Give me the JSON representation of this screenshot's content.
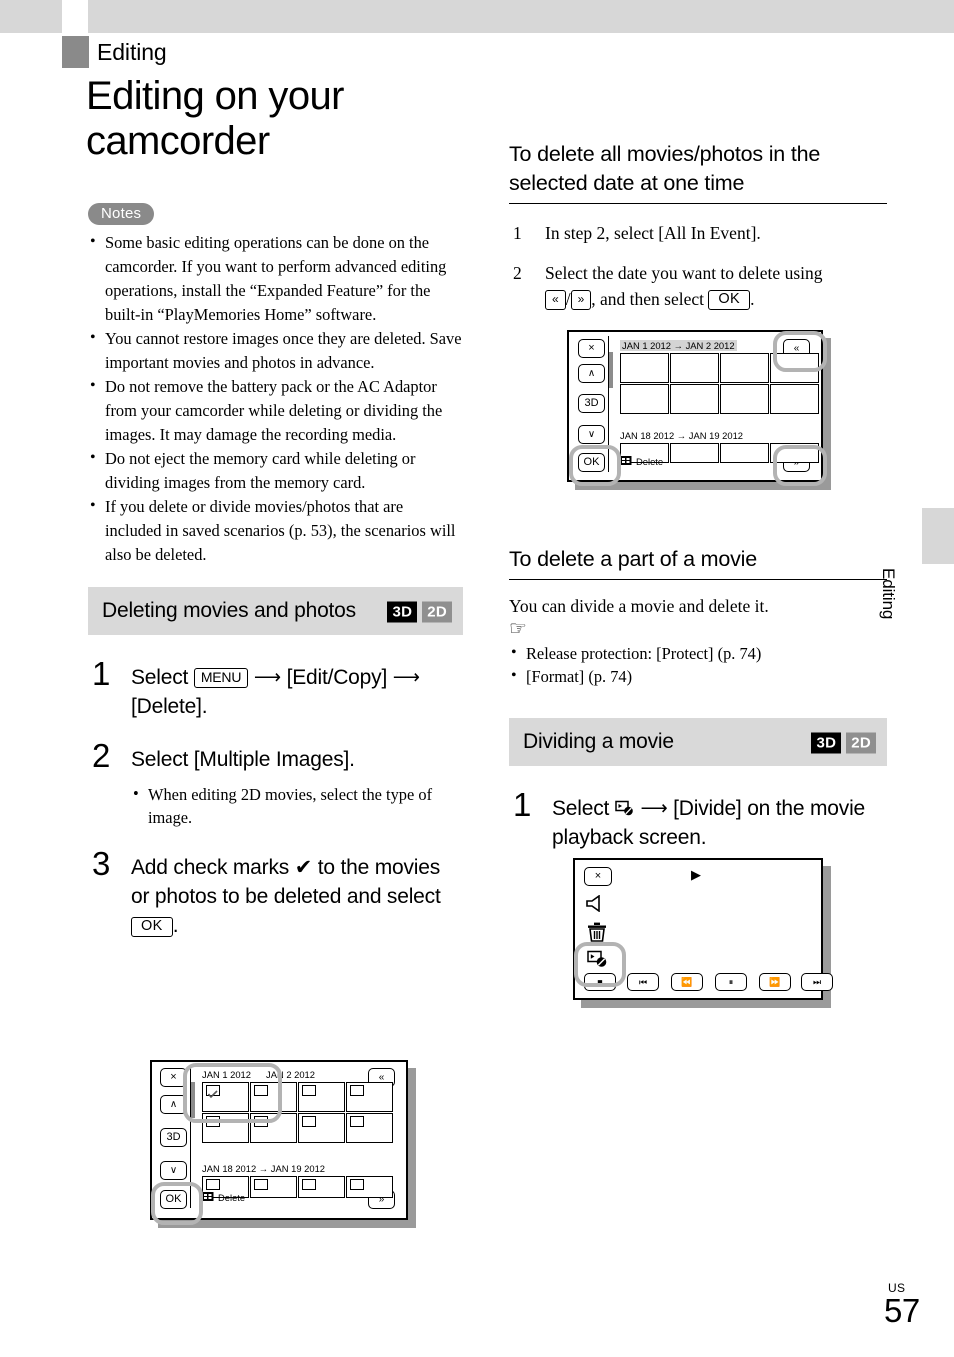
{
  "header": {
    "chapter": "Editing",
    "title": "Editing on your camcorder"
  },
  "side_tab": {
    "label": "Editing"
  },
  "footer": {
    "region": "US",
    "page_number": "57"
  },
  "notes": {
    "badge": "Notes",
    "items": [
      "Some basic editing operations can be done on the camcorder. If you want to perform advanced editing operations, install the “Expanded Feature” for the built-in “PlayMemories Home” software.",
      "You cannot restore images once they are deleted. Save important movies and photos in advance.",
      "Do not remove the battery pack or the AC Adaptor from your camcorder while deleting or dividing the images. It may damage the recording media.",
      "Do not eject the memory card while deleting or dividing images from the memory card.",
      "If you delete or divide movies/photos that are included in saved scenarios (p. 53), the scenarios will also be deleted."
    ]
  },
  "deleting_section": {
    "heading": "Deleting movies and photos",
    "badge_3d": "3D",
    "badge_2d": "2D",
    "steps": [
      {
        "number": "1",
        "text_before": "Select",
        "cap1": "MENU",
        "arrow1": "⟶",
        "text_mid": "[Edit/Copy]",
        "arrow2": "⟶",
        "text_after": "[Delete]."
      },
      {
        "number": "2",
        "text": "Select [Multiple Images].",
        "sub": "When editing 2D movies, select the type of image."
      },
      {
        "number": "3",
        "text_before": "Add check marks ✔ to the movies or photos to be deleted and select",
        "cap": "OK",
        "text_after": "."
      }
    ]
  },
  "screen_thumbnail_select": {
    "close_button": "×",
    "up_button": "∧",
    "mode_button": "3D",
    "down_button": "∨",
    "ok_button": "OK",
    "page_up_button": "«",
    "page_down_button": "»",
    "date_label_1": "JAN 1 2012",
    "date_label_2": "JAN 2 2012",
    "date_label_3": "JAN 18 2012 → JAN 19 2012",
    "status_text": "Delete"
  },
  "delete_all_section": {
    "heading": "To delete all movies/photos in the selected date at one time",
    "steps": [
      {
        "number": "1",
        "text": "In step 2, select [All In Event]."
      },
      {
        "number": "2",
        "text_before": "Select the date you want to delete using",
        "cap_up": "«",
        "separator": "/",
        "cap_down": "»",
        "text_mid": ", and then select",
        "cap_ok": "OK",
        "text_after": "."
      }
    ]
  },
  "screen_event_select": {
    "close_button": "×",
    "up_button": "∧",
    "mode_button": "3D",
    "down_button": "∨",
    "ok_button": "OK",
    "page_up_button": "«",
    "page_down_button": "»",
    "date_label_1": "JAN 1 2012 → JAN 2 2012",
    "date_label_2": "JAN 18 2012 → JAN 19 2012",
    "status_text": "Delete"
  },
  "delete_part_section": {
    "heading": "To delete a part of a movie",
    "body": "You can divide a movie and delete it.",
    "hand_icon": "☞",
    "links": [
      "Release protection: [Protect] (p. 74)",
      "[Format] (p. 74)"
    ]
  },
  "dividing_section": {
    "heading": "Dividing a movie",
    "badge_3d": "3D",
    "badge_2d": "2D",
    "step": {
      "number": "1",
      "text_before": "Select",
      "icon": "divide-icon",
      "arrow": "⟶",
      "text_after": "[Divide] on the movie playback screen."
    }
  },
  "screen_playback": {
    "close_button": "×",
    "volume_icon": "speaker-icon",
    "delete_icon": "trash-icon",
    "divide_icon": "divide-icon",
    "play_indicator": "▶",
    "stop_button": "■",
    "prev_button": "⏮",
    "rewind_button": "⏪",
    "pause_button": "⏸",
    "forward_button": "⏩",
    "next_button": "⏭"
  }
}
